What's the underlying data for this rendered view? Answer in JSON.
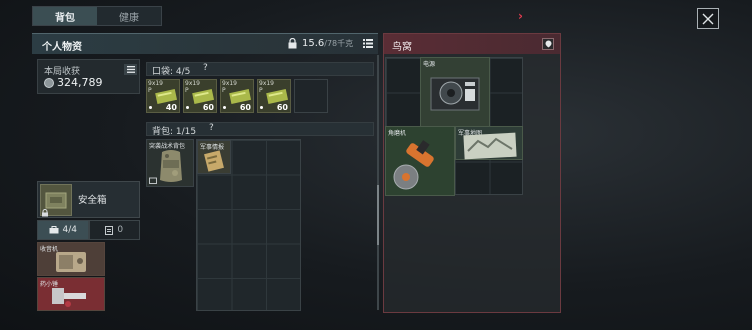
{
  "tabs": [
    {
      "label": "背包",
      "active": true
    },
    {
      "label": "健康",
      "active": false
    }
  ],
  "header": {
    "title": "个人物资",
    "weight_value": "15.6",
    "weight_max": "/78千克"
  },
  "income": {
    "label": "本局收获",
    "value": "324,789"
  },
  "pocket": {
    "label": "口袋: 4/5",
    "help": "?",
    "ammo": [
      {
        "caliber": "9x19",
        "sub": "P",
        "count": "40"
      },
      {
        "caliber": "9x19",
        "sub": "P",
        "count": "60"
      },
      {
        "caliber": "9x19",
        "sub": "P",
        "count": "60"
      },
      {
        "caliber": "9x19",
        "sub": "P",
        "count": "60"
      }
    ]
  },
  "backpack": {
    "label": "背包: 1/15",
    "help": "?",
    "items": [
      {
        "name": "突袭战术背包"
      },
      {
        "name": "军事情报"
      }
    ]
  },
  "safebox": {
    "label": "安全箱"
  },
  "box_counts": {
    "first": "4/4",
    "second": "0"
  },
  "safe_items": [
    {
      "name": "收音机"
    },
    {
      "name": "药小锤"
    }
  ],
  "nest": {
    "title": "鸟窝",
    "items": [
      {
        "name": "电源"
      },
      {
        "name": "角磨机"
      },
      {
        "name": "军事地图"
      }
    ]
  },
  "colors": {
    "accent_red": "#e03b4f",
    "tab_active": "#3b4e53",
    "nest_header": "#5a2d35"
  }
}
